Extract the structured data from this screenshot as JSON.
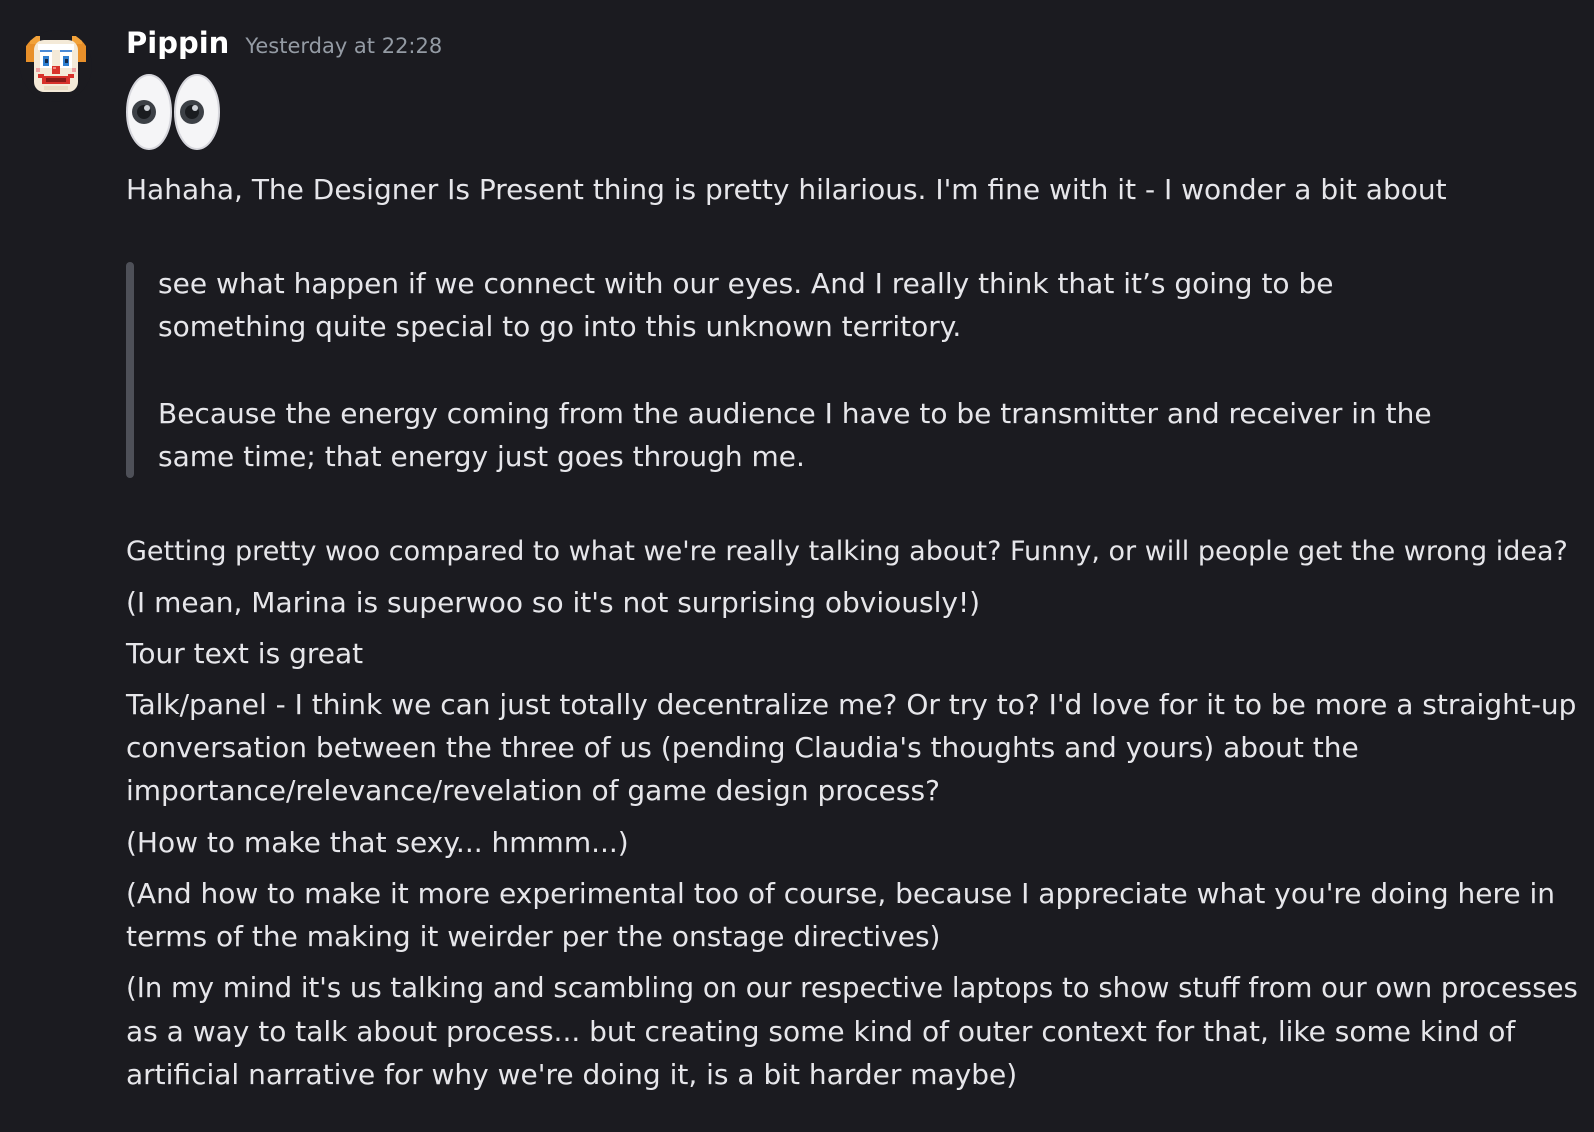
{
  "message": {
    "author": "Pippin",
    "timestamp": "Yesterday at 22:28",
    "avatar_icon": "clown-face-pixel-icon",
    "emoji": "eyes-emoji-icon",
    "intro": "Hahaha, The Designer Is Present thing is pretty hilarious. I'm fine with it - I wonder a bit about",
    "quote": {
      "lines": [
        "see what happen if we connect with our eyes. And I really think that it’s going to be",
        "something quite special to go into this unknown territory.",
        "Because the energy coming from the audience I have to be transmitter and receiver in the",
        "same time; that energy just goes through me."
      ]
    },
    "lines": [
      "Getting pretty woo compared to what we're really talking about? Funny, or will people get the wrong idea?",
      "(I mean, Marina is superwoo so it's not surprising obviously!)",
      "Tour text is great",
      "Talk/panel - I think we can just totally decentralize me? Or try to? I'd love for it to be more a straight-up",
      "conversation between the three of us (pending Claudia's thoughts and yours) about the",
      "importance/relevance/revelation of game design process?",
      "(How to make that sexy... hmmm...)",
      "(And how to make it more experimental too of course, because I appreciate what you're doing here in",
      "terms of the making it weirder per the onstage directives)",
      "(In my mind it's us talking and scambling on our respective laptops to show stuff from our own processes",
      "as a way to talk about process... but creating some kind of outer context for that, like some kind of",
      "artificial narrative for why we're doing it, is a bit harder maybe)"
    ]
  },
  "colors": {
    "background": "#1b1b20",
    "text": "#e6e6ea",
    "username": "#ffffff",
    "timestamp": "#949ba4",
    "quote_bar": "#4e5058"
  }
}
